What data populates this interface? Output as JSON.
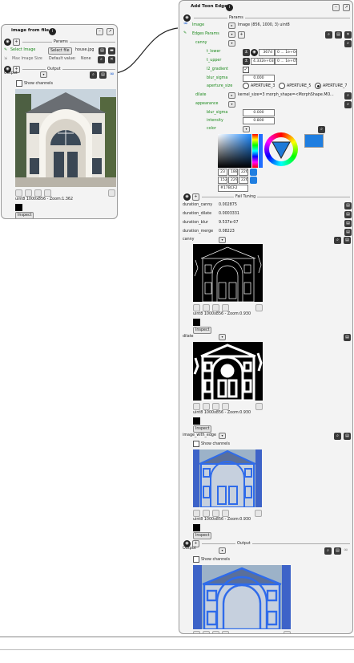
{
  "left_node": {
    "title": "image from file",
    "params_label": "Params",
    "select_image_label": "Select Image",
    "select_file_button": "Select file",
    "filename": "house.jpg",
    "max_image_size_label": "Max Image Size",
    "default_value_label": "Default value:",
    "default_value": "None",
    "output_section_label": "Output",
    "output_label": "Output",
    "show_channels_label": "Show channels",
    "image_info": "uint8 1000x856 - Zoom:1.362",
    "inspect_button": "Inspect"
  },
  "right_node": {
    "title": "Add Toon Edges",
    "params_label": "Params",
    "image_input_label": "Image",
    "image_input_value": "Image (856, 1000, 3) uint8",
    "edges_params_label": "Edges Params",
    "canny_label": "canny",
    "t_lower_label": "t_lower",
    "t_lower_value": "367d",
    "t_lower_range": "0 ... 1e+04",
    "t_upper_label": "t_upper",
    "t_upper_value": "4.332e+03",
    "t_upper_range": "0 ... 1e+05",
    "l2_gradient_label": "l2_gradient",
    "blur_sigma_label": "blur_sigma",
    "blur_sigma_value": "0.000",
    "aperture_size_label": "aperture_size",
    "aperture_options": [
      "APERTURE_3",
      "APERTURE_5",
      "APERTURE_7"
    ],
    "aperture_selected": "APERTURE_7",
    "dilate_label": "dilate",
    "dilate_value": "kernel_size=3 morph_shape=<MorphShape.MO...",
    "appearance_label": "appearance",
    "appearance_blur_sigma_label": "blur_sigma",
    "appearance_blur_sigma_value": "0.000",
    "intensity_label": "intensity",
    "intensity_value": "0.800",
    "color_label": "color",
    "color_hex": "#17BCF2",
    "color_r": "23",
    "color_g": "188",
    "color_b": "226",
    "color_r2": "152",
    "color_g2": "229",
    "color_b2": "226",
    "color_hex_field": "#17BCF2",
    "accent_color": "#1e78d8",
    "fail_tuning_label": "Fail Tuning",
    "durations": [
      {
        "label": "duration_canny",
        "value": "0.002875"
      },
      {
        "label": "duration_dilate",
        "value": "0.0003331"
      },
      {
        "label": "duration_blur",
        "value": "9.537e-07"
      },
      {
        "label": "duration_merge",
        "value": "0.08223"
      }
    ],
    "canny_img_label": "canny",
    "canny_info": "uint8 1000x856 - Zoom:0.930",
    "inspect_button": "Inspect",
    "dilate_img_label": "dilate",
    "dilate_info": "uint8 1000x856 - Zoom:0.930",
    "image_with_edges_label": "image_with_edge",
    "show_channels_label": "Show channels",
    "iwe_info": "uint8 1000x856 - Zoom:0.930",
    "output_section_label": "Output",
    "output_label": "Output",
    "output_show_channels_label": "Show channels"
  }
}
